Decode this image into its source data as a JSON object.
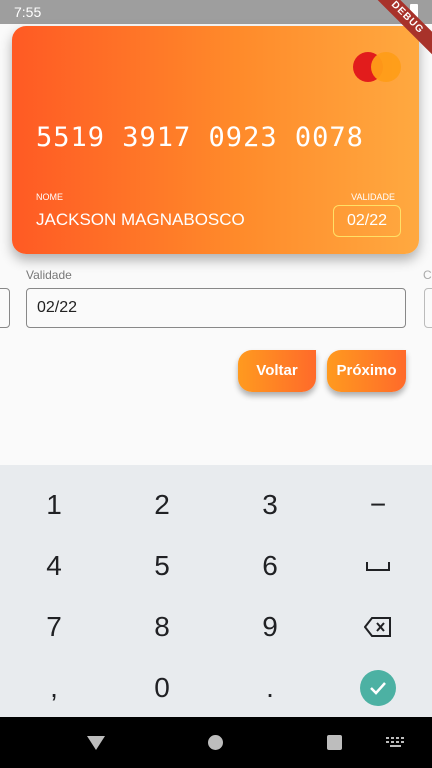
{
  "status": {
    "time": "7:55",
    "debug_banner": "DEBUG"
  },
  "card": {
    "number": "5519 3917 0923 0078",
    "name_label": "NOME",
    "name": "JACKSON MAGNABOSCO",
    "expiry_label": "VALIDADE",
    "expiry": "02/22",
    "brand_icon": "mastercard-logo",
    "gradient": [
      "#ff5a24",
      "#ffa940"
    ]
  },
  "form": {
    "expiry_label": "Validade",
    "expiry_value": "02/22",
    "next_field_label": "C"
  },
  "buttons": {
    "back": "Voltar",
    "next": "Próximo",
    "color": "#ff8a24"
  },
  "keyboard": {
    "keys": [
      "1",
      "2",
      "3",
      "−",
      "4",
      "5",
      "6",
      "␣",
      "7",
      "8",
      "9",
      "⌫",
      ",",
      "0",
      ".",
      "✓"
    ],
    "accent": "#4cb1a3"
  }
}
